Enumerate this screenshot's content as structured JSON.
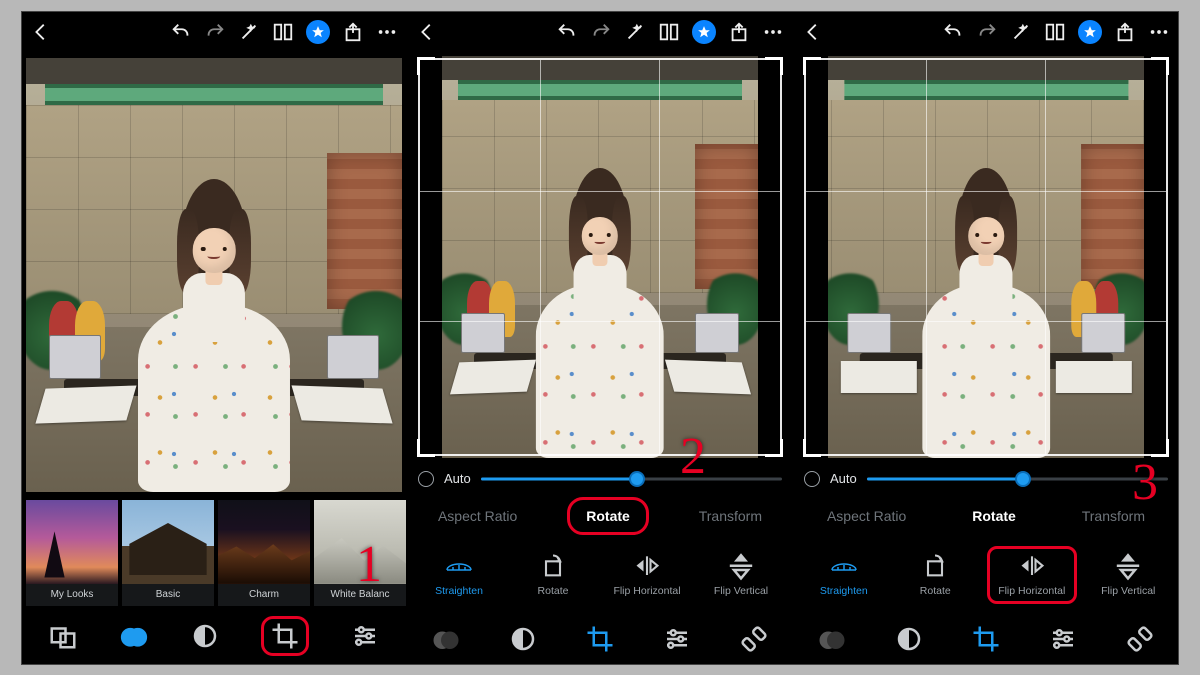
{
  "annotations": {
    "step1": "1",
    "step2": "2",
    "step3": "3"
  },
  "highlight_color": "#e60023",
  "accent_color": "#1e9bf0",
  "topbar_icons": [
    "back",
    "undo",
    "redo",
    "auto-enhance",
    "before-after",
    "premium-star",
    "share",
    "more"
  ],
  "screen1": {
    "presets": [
      {
        "id": "my-looks",
        "label": "My Looks",
        "thumb": "sunset"
      },
      {
        "id": "basic",
        "label": "Basic",
        "thumb": "house"
      },
      {
        "id": "charm",
        "label": "Charm",
        "thumb": "charm"
      },
      {
        "id": "white-balance",
        "label": "White Balanc",
        "thumb": "wb"
      }
    ],
    "toolbar": [
      "presets",
      "light",
      "effects",
      "crop",
      "detail"
    ],
    "active_tool": "light",
    "highlighted_tool": "crop"
  },
  "crop_common": {
    "auto_label": "Auto",
    "slider_value_pct": 52,
    "tabs": [
      "Aspect Ratio",
      "Rotate",
      "Transform"
    ],
    "active_tab": "Rotate",
    "ops": [
      {
        "id": "straighten",
        "label": "Straighten"
      },
      {
        "id": "rotate",
        "label": "Rotate"
      },
      {
        "id": "flip-horizontal",
        "label": "Flip Horizontal"
      },
      {
        "id": "flip-vertical",
        "label": "Flip Vertical"
      }
    ],
    "active_op": "straighten",
    "nav": [
      "presets",
      "effects",
      "crop",
      "detail",
      "heal"
    ],
    "active_nav": "crop"
  },
  "screen2": {
    "mirrored": false,
    "highlight_tab": "Rotate"
  },
  "screen3": {
    "mirrored": true,
    "highlight_op": "flip-horizontal"
  }
}
